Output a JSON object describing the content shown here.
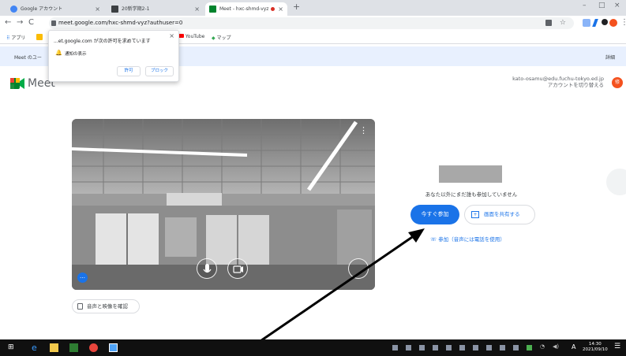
{
  "tabs": [
    {
      "label": "Google アカウント",
      "active": false
    },
    {
      "label": "20新学期2-1",
      "active": false
    },
    {
      "label": "Meet - hxc-shmd-vyz",
      "active": true
    }
  ],
  "address_bar": {
    "url": "meet.google.com/hxc-shmd-vyz?authuser=0"
  },
  "bookmarks": {
    "apps": "アプリ",
    "youtube": "YouTube",
    "maps": "マップ"
  },
  "notice_bar": {
    "text": "Meet のユー",
    "details": "詳細"
  },
  "permission_popup": {
    "title": "...et.google.com が次の許可を求めています",
    "item": "通知の表示",
    "allow": "許可",
    "block": "ブロック"
  },
  "meet": {
    "logo_text": "Meet",
    "account_email": "kato-osamu@edu.fuchu-tokyo.ed.jp",
    "account_switch": "アカウントを切り替える",
    "avatar_initial": "修"
  },
  "join_panel": {
    "nobody_text": "あなた以外にまだ誰も参加していません",
    "join_now": "今すぐ参加",
    "present": "画面を共有する",
    "phone_join": "参加（音声には電話を使用）"
  },
  "video": {
    "check_av": "音声と映像を確認"
  },
  "taskbar": {
    "time": "14:30",
    "date": "2021/09/10",
    "ime": "A"
  },
  "colors": {
    "accent": "#1a73e8",
    "taskbar": "#101010",
    "notice": "#e8f0fe"
  }
}
